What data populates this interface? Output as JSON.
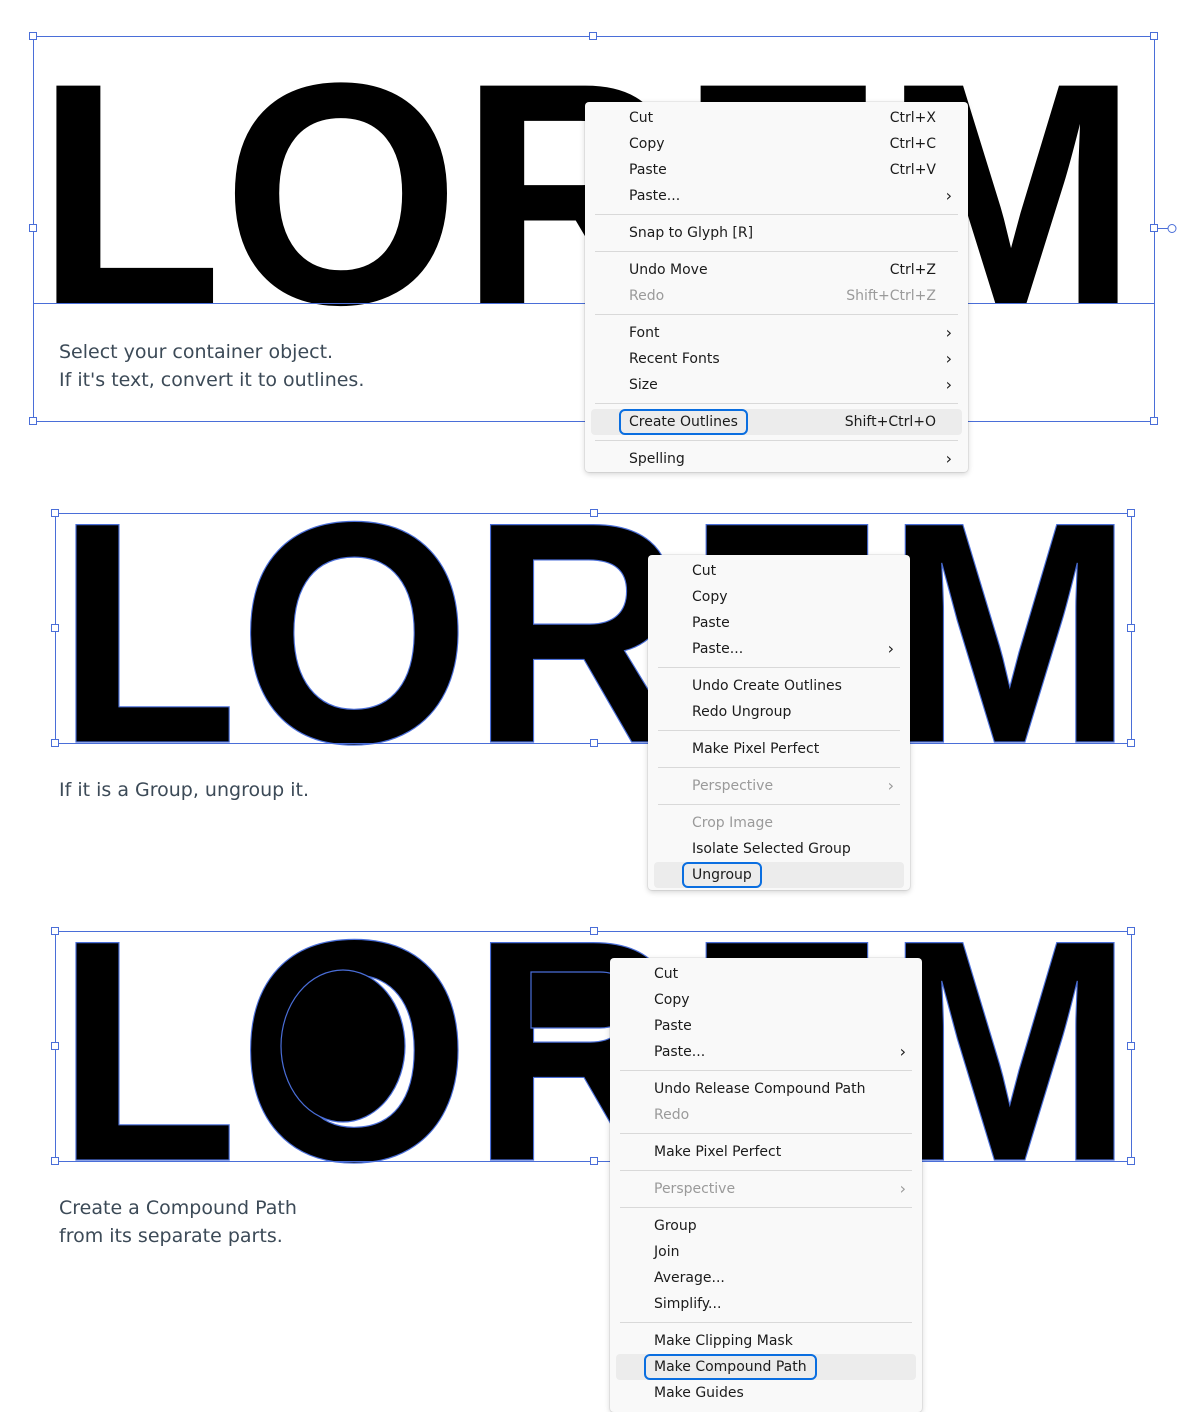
{
  "artwork": {
    "word": "LOREM"
  },
  "steps": [
    {
      "caption": [
        "Select your container object.",
        "If it's text, convert it to outlines."
      ],
      "menu": [
        {
          "label": "Cut",
          "shortcut": "Ctrl+X"
        },
        {
          "label": "Copy",
          "shortcut": "Ctrl+C"
        },
        {
          "label": "Paste",
          "shortcut": "Ctrl+V"
        },
        {
          "label": "Paste...",
          "submenu": true
        },
        {
          "separator": true
        },
        {
          "label": "Snap to Glyph [R]"
        },
        {
          "separator": true
        },
        {
          "label": "Undo Move",
          "shortcut": "Ctrl+Z"
        },
        {
          "label": "Redo",
          "shortcut": "Shift+Ctrl+Z",
          "disabled": true
        },
        {
          "separator": true
        },
        {
          "label": "Font",
          "submenu": true
        },
        {
          "label": "Recent Fonts",
          "submenu": true
        },
        {
          "label": "Size",
          "submenu": true
        },
        {
          "separator": true
        },
        {
          "label": "Create Outlines",
          "shortcut": "Shift+Ctrl+O",
          "highlighted": true
        },
        {
          "separator": true
        },
        {
          "label": "Spelling",
          "submenu": true
        }
      ]
    },
    {
      "caption": [
        "If it is a Group, ungroup it."
      ],
      "menu": [
        {
          "label": "Cut"
        },
        {
          "label": "Copy"
        },
        {
          "label": "Paste"
        },
        {
          "label": "Paste...",
          "submenu": true
        },
        {
          "separator": true
        },
        {
          "label": "Undo Create Outlines"
        },
        {
          "label": "Redo Ungroup"
        },
        {
          "separator": true
        },
        {
          "label": "Make Pixel Perfect"
        },
        {
          "separator": true
        },
        {
          "label": "Perspective",
          "submenu": true,
          "disabled": true
        },
        {
          "separator": true
        },
        {
          "label": "Crop Image",
          "disabled": true
        },
        {
          "label": "Isolate Selected Group"
        },
        {
          "label": "Ungroup",
          "highlighted": true
        }
      ]
    },
    {
      "caption": [
        "Create a Compound Path",
        "from its separate parts."
      ],
      "menu": [
        {
          "label": "Cut"
        },
        {
          "label": "Copy"
        },
        {
          "label": "Paste"
        },
        {
          "label": "Paste...",
          "submenu": true
        },
        {
          "separator": true
        },
        {
          "label": "Undo Release Compound Path"
        },
        {
          "label": "Redo",
          "disabled": true
        },
        {
          "separator": true
        },
        {
          "label": "Make Pixel Perfect"
        },
        {
          "separator": true
        },
        {
          "label": "Perspective",
          "submenu": true,
          "disabled": true
        },
        {
          "separator": true
        },
        {
          "label": "Group"
        },
        {
          "label": "Join"
        },
        {
          "label": "Average..."
        },
        {
          "label": "Simplify..."
        },
        {
          "separator": true
        },
        {
          "label": "Make Clipping Mask"
        },
        {
          "label": "Make Compound Path",
          "highlighted": true
        },
        {
          "label": "Make Guides"
        }
      ]
    }
  ],
  "colors": {
    "selection": "#4a6ed8",
    "highlight_ring": "#0a6ee0",
    "caption": "#3c4a57"
  }
}
